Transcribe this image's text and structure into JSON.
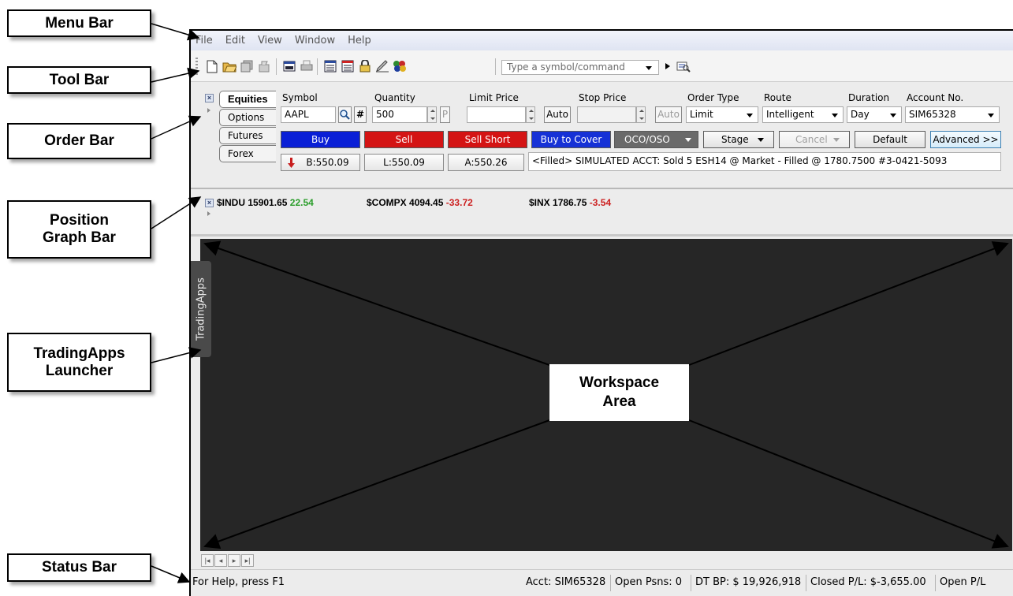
{
  "callouts": {
    "menu_bar": "Menu Bar",
    "tool_bar": "Tool Bar",
    "order_bar": "Order Bar",
    "position_graph_bar_1": "Position",
    "position_graph_bar_2": "Graph Bar",
    "tradingapps_1": "TradingApps",
    "tradingapps_2": "Launcher",
    "status_bar": "Status Bar"
  },
  "menu": [
    "File",
    "Edit",
    "View",
    "Window",
    "Help"
  ],
  "toolbar": {
    "command_placeholder": "Type a symbol/command",
    "icons": [
      "new-document-icon",
      "open-folder-icon",
      "copy-layout-icon",
      "save-icon",
      "print-icon",
      "printer-icon",
      "window-layout-icon",
      "workspace-icon",
      "lock-icon",
      "edit-icon",
      "apps-icon",
      "go-arrow-icon",
      "find-icon"
    ]
  },
  "order_bar": {
    "tabs": [
      "Equities",
      "Options",
      "Futures",
      "Forex"
    ],
    "labels": {
      "symbol": "Symbol",
      "quantity": "Quantity",
      "limit_price": "Limit Price",
      "stop_price": "Stop Price",
      "order_type": "Order Type",
      "route": "Route",
      "duration": "Duration",
      "account_no": "Account No."
    },
    "values": {
      "symbol": "AAPL",
      "quantity": "500",
      "limit_price": "",
      "stop_price": "",
      "order_type": "Limit",
      "route": "Intelligent",
      "duration": "Day",
      "account_no": "SIM65328"
    },
    "small_buttons": {
      "hash": "#",
      "p": "P",
      "auto": "Auto"
    },
    "buttons": {
      "buy": "Buy",
      "sell": "Sell",
      "sell_short": "Sell Short",
      "buy_to_cover": "Buy to Cover",
      "oco_oso": "OCO/OSO",
      "stage": "Stage",
      "cancel": "Cancel",
      "default": "Default",
      "advanced": "Advanced >>"
    },
    "quotes": {
      "bid": "B:550.09",
      "last": "L:550.09",
      "ask": "A:550.26"
    },
    "message": "<Filled> SIMULATED ACCT: Sold 5 ESH14 @ Market - Filled @ 1780.7500 #3-0421-5093"
  },
  "position_bar": {
    "indices": [
      {
        "symbol": "$INDU",
        "price": "15901.65",
        "change": "22.54"
      },
      {
        "symbol": "$COMPX",
        "price": "4094.45",
        "change": "-33.72"
      },
      {
        "symbol": "$INX",
        "price": "1786.75",
        "change": "-3.54"
      }
    ]
  },
  "tradingapps_tab": "TradingApps",
  "workspace": {
    "label_1": "Workspace",
    "label_2": "Area"
  },
  "status_bar": {
    "help": "For Help, press F1",
    "acct": "Acct: SIM65328",
    "open_psns": "Open Psns: 0",
    "dt_bp": "DT BP: $ 19,926,918",
    "closed_pl": "Closed P/L: $-3,655.00",
    "open_pl": "Open P/L"
  },
  "colors": {
    "buy": "#0a1fd6",
    "sell": "#d41414",
    "up": "#2a9d2a",
    "down": "#cc2020",
    "workspace": "#262626"
  }
}
